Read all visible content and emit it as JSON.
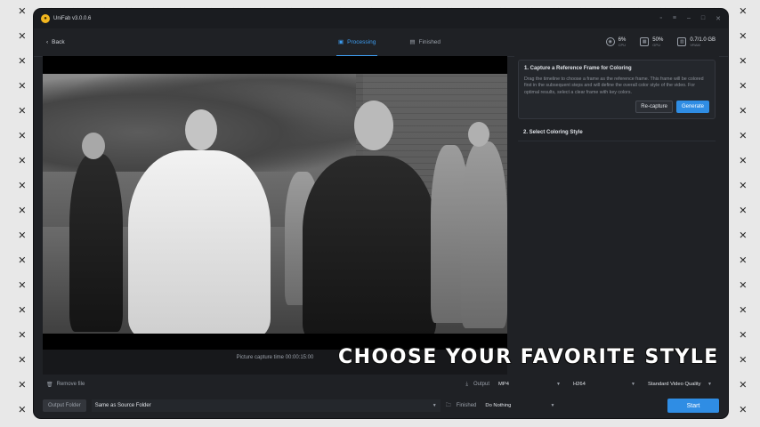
{
  "window": {
    "title": "UniFab v3.0.0.6"
  },
  "toolbar": {
    "back_label": "Back",
    "tabs": [
      {
        "label": "Processing",
        "active": true
      },
      {
        "label": "Finished",
        "active": false
      }
    ],
    "stats": [
      {
        "value": "6%",
        "label": "CPU",
        "icon": "cpu-icon"
      },
      {
        "value": "50%",
        "label": "GPU",
        "icon": "gpu-icon"
      },
      {
        "value": "0.7/1.0 GB",
        "label": "VRAM",
        "icon": "vram-icon"
      }
    ]
  },
  "preview": {
    "capture_time": "Picture capture time 00:00:15:00"
  },
  "panel": {
    "step1": {
      "title": "1. Capture a Reference Frame for Coloring",
      "description": "Drag the timeline to choose a frame as the reference frame. This frame will be colored first in the subsequent steps and will define the overall color style of the video. For optimal results, select a clear frame with key colors.",
      "recapture_label": "Re-capture",
      "generate_label": "Generate"
    },
    "step2": {
      "title": "2. Select Coloring Style"
    }
  },
  "bottom": {
    "remove_label": "Remove file",
    "output_label": "Output",
    "format": "MP4",
    "codec": "H264",
    "quality": "Standard Video Quality",
    "output_folder_label": "Output Folder",
    "folder_value": "Same as Source Folder",
    "finished_label": "Finished",
    "finished_value": "Do Nothing",
    "start_label": "Start"
  },
  "overlay": {
    "caption": "CHOOSE YOUR FAVORITE STYLE"
  },
  "colors": {
    "accent": "#2f8de4",
    "background": "#1f2125",
    "tab_active": "#3d9cf0"
  }
}
